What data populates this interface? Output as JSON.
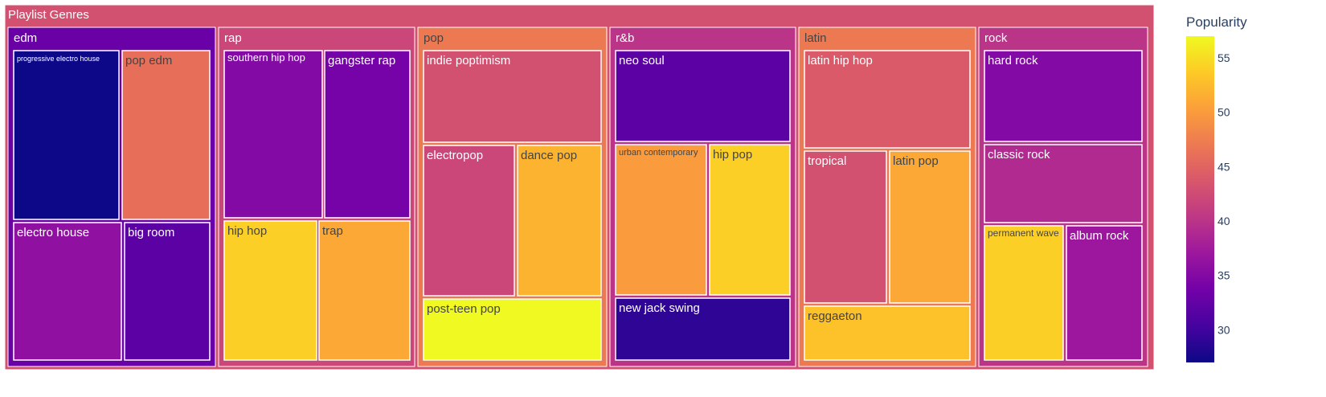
{
  "chart_data": {
    "type": "treemap",
    "root": {
      "name": "Playlist Genres",
      "value": 43
    },
    "groups": [
      {
        "name": "edm",
        "value": 33,
        "children": [
          {
            "name": "progressive electro house",
            "value": 27
          },
          {
            "name": "pop edm",
            "value": 46
          },
          {
            "name": "electro house",
            "value": 36
          },
          {
            "name": "big room",
            "value": 32
          }
        ]
      },
      {
        "name": "rap",
        "value": 42,
        "children": [
          {
            "name": "southern hip hop",
            "value": 35
          },
          {
            "name": "gangster rap",
            "value": 34
          },
          {
            "name": "hip hop",
            "value": 54
          },
          {
            "name": "trap",
            "value": 51
          }
        ]
      },
      {
        "name": "pop",
        "value": 47,
        "children": [
          {
            "name": "indie poptimism",
            "value": 43
          },
          {
            "name": "electropop",
            "value": 42
          },
          {
            "name": "dance pop",
            "value": 52
          },
          {
            "name": "post-teen pop",
            "value": 57
          }
        ]
      },
      {
        "name": "r&b",
        "value": 40,
        "children": [
          {
            "name": "neo soul",
            "value": 32
          },
          {
            "name": "urban contemporary",
            "value": 50
          },
          {
            "name": "hip pop",
            "value": 54
          },
          {
            "name": "new jack swing",
            "value": 29
          }
        ]
      },
      {
        "name": "latin",
        "value": 47,
        "children": [
          {
            "name": "latin hip hop",
            "value": 44
          },
          {
            "name": "tropical",
            "value": 43
          },
          {
            "name": "latin pop",
            "value": 51
          },
          {
            "name": "reggaeton",
            "value": 53
          }
        ]
      },
      {
        "name": "rock",
        "value": 40,
        "children": [
          {
            "name": "hard rock",
            "value": 35
          },
          {
            "name": "classic rock",
            "value": 39
          },
          {
            "name": "permanent wave",
            "value": 54
          },
          {
            "name": "album rock",
            "value": 37
          }
        ]
      }
    ],
    "colorbar": {
      "title": "Popularity",
      "range": [
        27,
        57
      ],
      "ticks": [
        30,
        35,
        40,
        45,
        50,
        55
      ]
    },
    "colorscale": "Plasma"
  }
}
